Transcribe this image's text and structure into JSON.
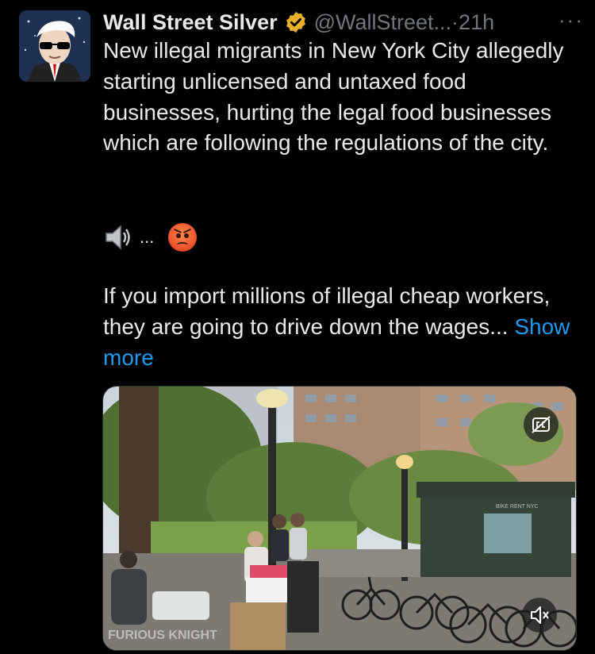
{
  "tweet": {
    "author_name": "Wall Street Silver",
    "handle": "@WallStreet...",
    "separator": "·",
    "time": "21h",
    "more_label": "···",
    "paragraph1": "New illegal migrants in New York City allegedly starting unlicensed and untaxed food businesses, hurting the legal food businesses which are following the regulations of the city.",
    "emoji_ellipsis": "...",
    "paragraph3_text": "If you import millions of illegal cheap workers, they are going to drive down the wages...",
    "show_more": "Show more",
    "verified_color": "#e9b12b",
    "link_color": "#1d9bf0"
  },
  "media": {
    "watermark": "FURIOUS KNIGHT",
    "kiosk_sign": "BIKE RENT NYC"
  }
}
